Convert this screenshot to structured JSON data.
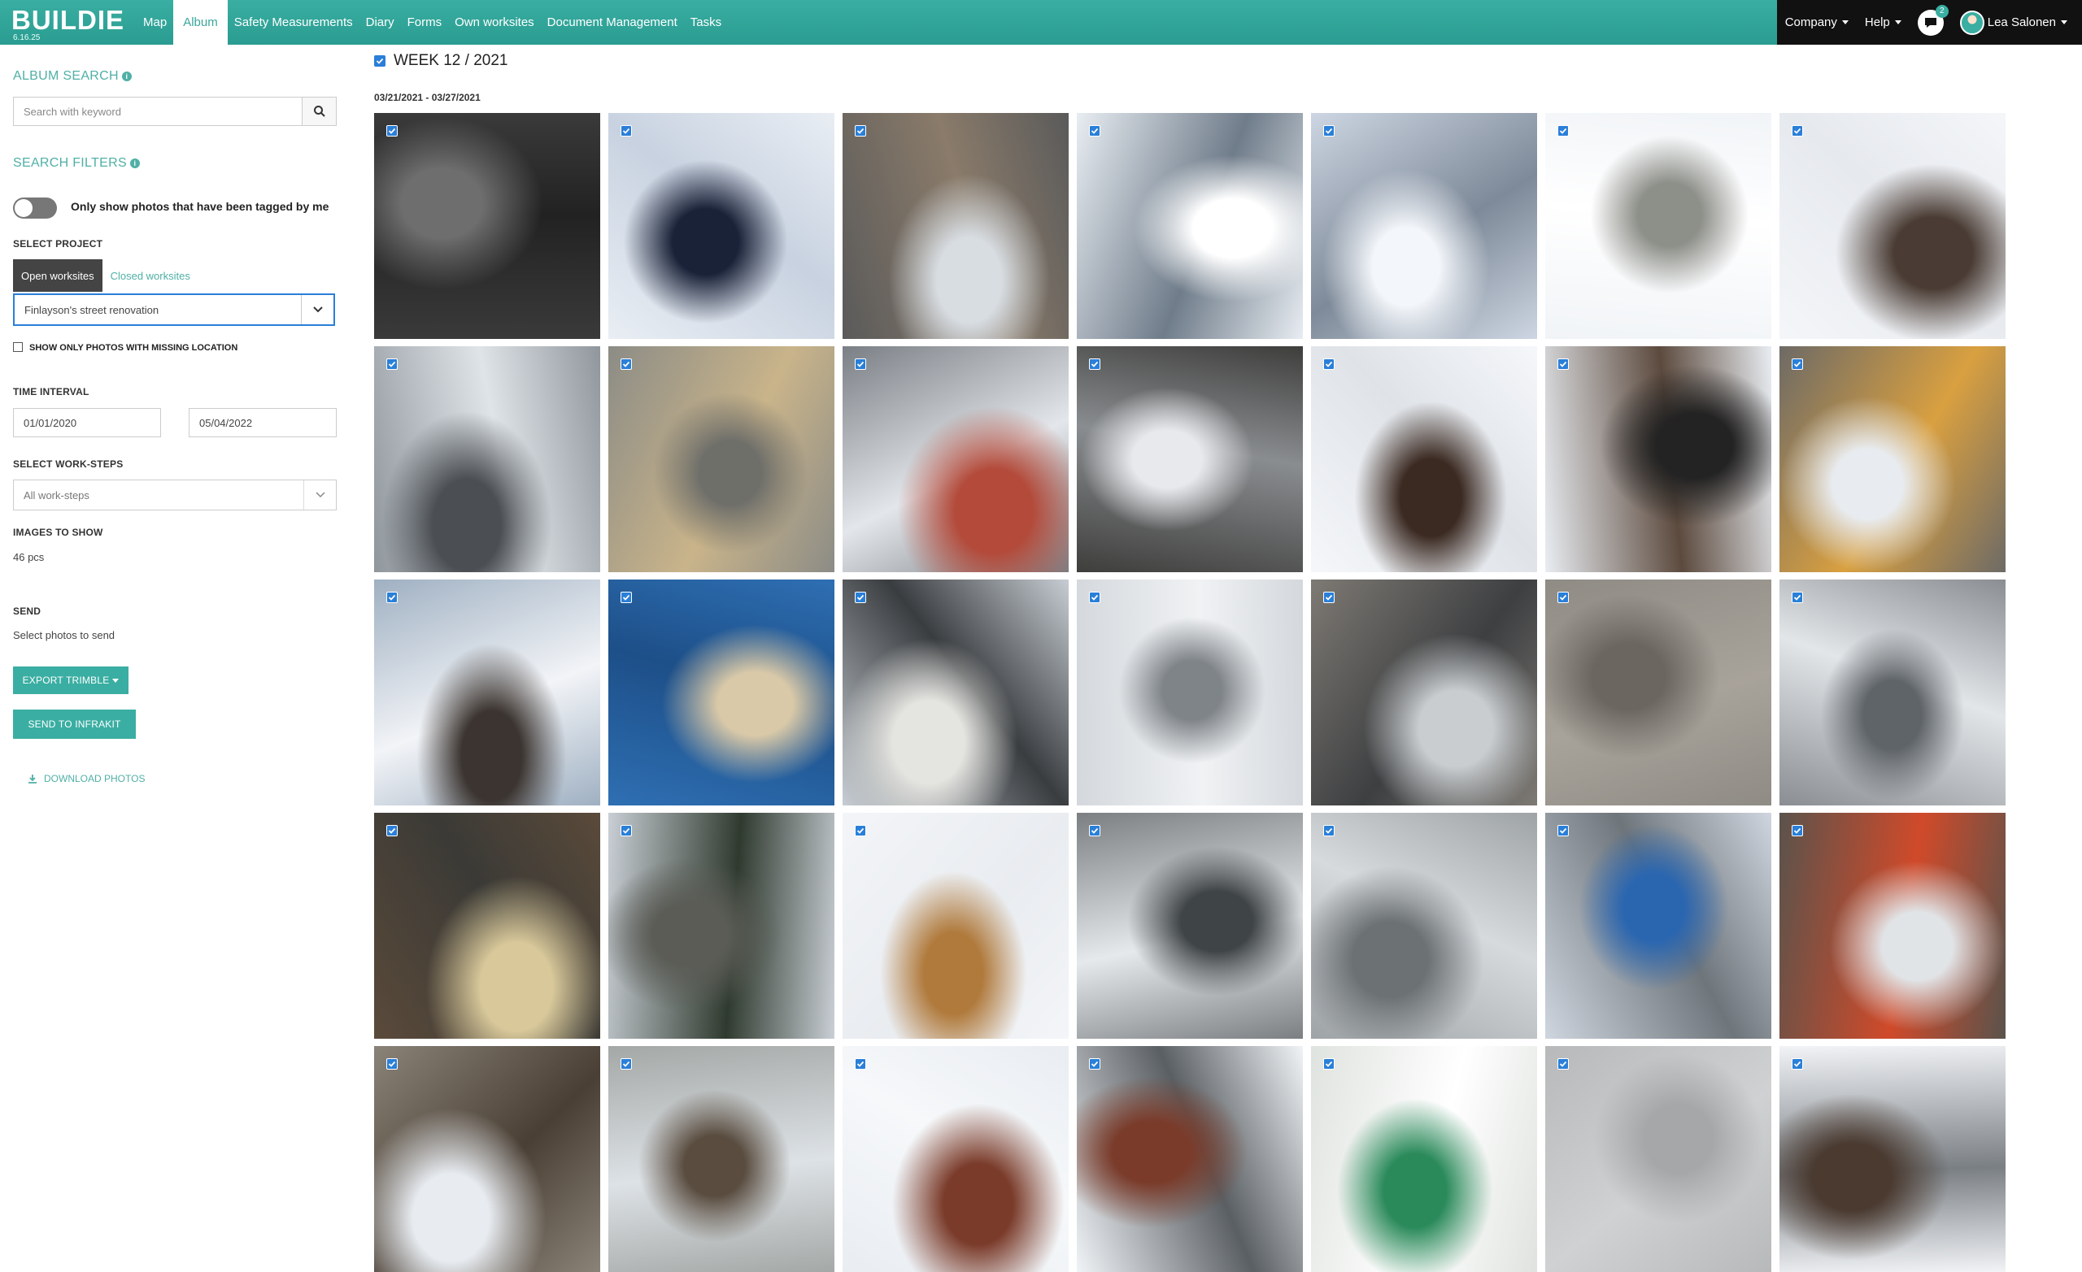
{
  "app": {
    "logo": "BUILDIE",
    "version": "6.16.25"
  },
  "nav": {
    "items": [
      "Map",
      "Album",
      "Safety Measurements",
      "Diary",
      "Forms",
      "Own worksites",
      "Document Management",
      "Tasks"
    ],
    "active": "Album"
  },
  "topright": {
    "company": "Company",
    "help": "Help",
    "chat_count": "2",
    "user_name": "Lea Salonen"
  },
  "sidebar": {
    "album_search_title": "ALBUM SEARCH",
    "search_placeholder": "Search with keyword",
    "search_filters_title": "SEARCH FILTERS",
    "tagged_toggle_label": "Only show photos that have been tagged by me",
    "select_project_label": "SELECT PROJECT",
    "tab_open": "Open worksites",
    "tab_closed": "Closed worksites",
    "project_selected": "Finlayson's street renovation",
    "missing_location_label": "SHOW ONLY PHOTOS WITH MISSING LOCATION",
    "time_interval_label": "TIME INTERVAL",
    "date_from": "01/01/2020",
    "date_to": "05/04/2022",
    "work_steps_label": "SELECT WORK-STEPS",
    "work_steps_value": "All work-steps",
    "images_label": "IMAGES TO SHOW",
    "images_value": "46 pcs",
    "send_label": "SEND",
    "send_hint": "Select photos to send",
    "export_button": "EXPORT TRIMBLE",
    "infrakit_button": "SEND TO INFRAKIT",
    "download_link": "DOWNLOAD PHOTOS"
  },
  "album": {
    "week_title": "WEEK 12 / 2021",
    "date_range": "03/21/2021 - 03/27/2021",
    "photo_count": 35
  },
  "colors": {
    "brand": "#3aaea2",
    "topbar_dark": "#111111",
    "checkbox": "#2a7fd8"
  }
}
